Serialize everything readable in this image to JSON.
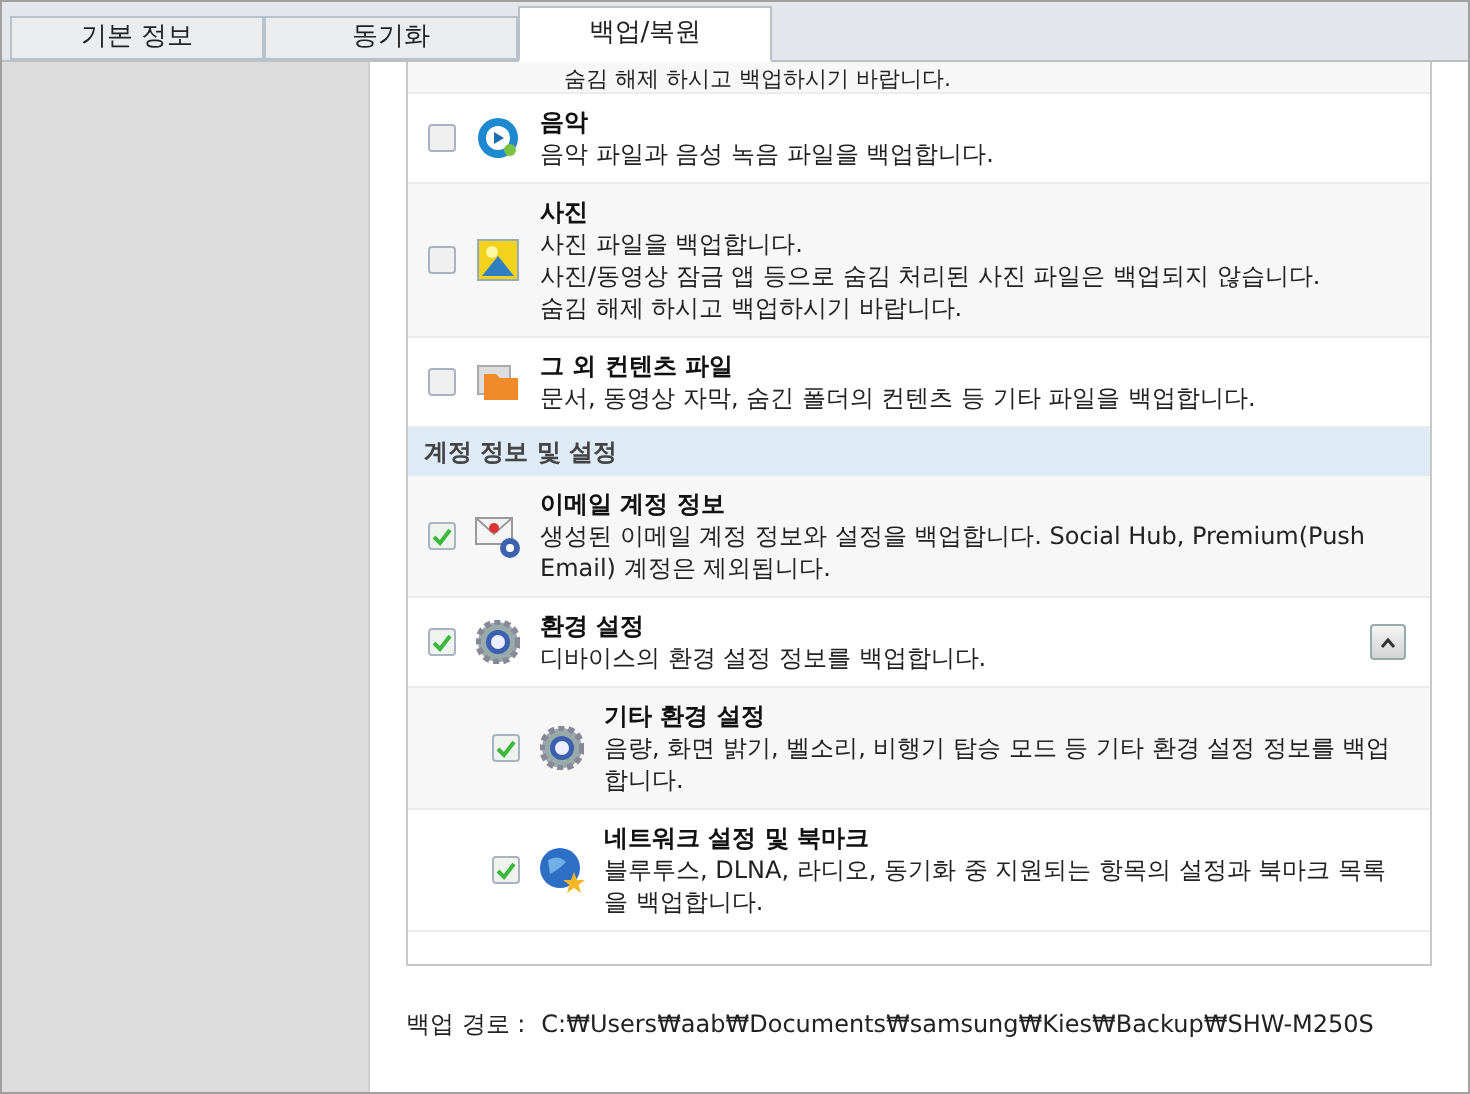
{
  "tabs": [
    {
      "label": "기본 정보",
      "selected": false
    },
    {
      "label": "동기화",
      "selected": false
    },
    {
      "label": "백업/복원",
      "selected": true
    }
  ],
  "list": [
    {
      "kind": "note",
      "text": "숨김 해제 하시고 백업하시기 바랍니다."
    },
    {
      "kind": "item",
      "checked": false,
      "title": "음악",
      "description": [
        "음악 파일과 음성 녹음 파일을 백업합니다."
      ]
    },
    {
      "kind": "item",
      "checked": false,
      "title": "사진",
      "description": [
        "사진 파일을 백업합니다.",
        "사진/동영상 잠금 앱 등으로 숨김 처리된 사진 파일은 백업되지 않습니다.",
        "숨김 해제 하시고 백업하시기 바랍니다."
      ]
    },
    {
      "kind": "item",
      "checked": false,
      "title": "그 외 컨텐츠 파일",
      "description": [
        "문서, 동영상 자막, 숨긴 폴더의 컨텐츠 등 기타 파일을 백업합니다."
      ]
    },
    {
      "kind": "section",
      "text": "계정 정보 및 설정"
    },
    {
      "kind": "item",
      "checked": true,
      "title": "이메일 계정 정보",
      "description": [
        "생성된 이메일 계정 정보와 설정을 백업합니다. Social Hub, Premium(Push Email) 계정은 제외됩니다."
      ]
    },
    {
      "kind": "item",
      "checked": true,
      "title": "환경 설정",
      "description": [
        "디바이스의 환경 설정 정보를 백업합니다."
      ],
      "expanded": true,
      "children": [
        {
          "checked": true,
          "title": "기타 환경 설정",
          "description": [
            "음량, 화면 밝기, 벨소리, 비행기 탑승 모드 등 기타 환경 설정 정보를 백업합니다."
          ]
        },
        {
          "checked": true,
          "title": "네트워크 설정 및 북마크",
          "description": [
            "블루투스, DLNA, 라디오, 동기화 중 지원되는 항목의 설정과 북마크 목록을 백업합니다."
          ]
        }
      ]
    }
  ],
  "backup_path": {
    "label": "백업 경로 :",
    "value": "C:₩Users₩aab₩Documents₩samsung₩Kies₩Backup₩SHW-M250S"
  }
}
